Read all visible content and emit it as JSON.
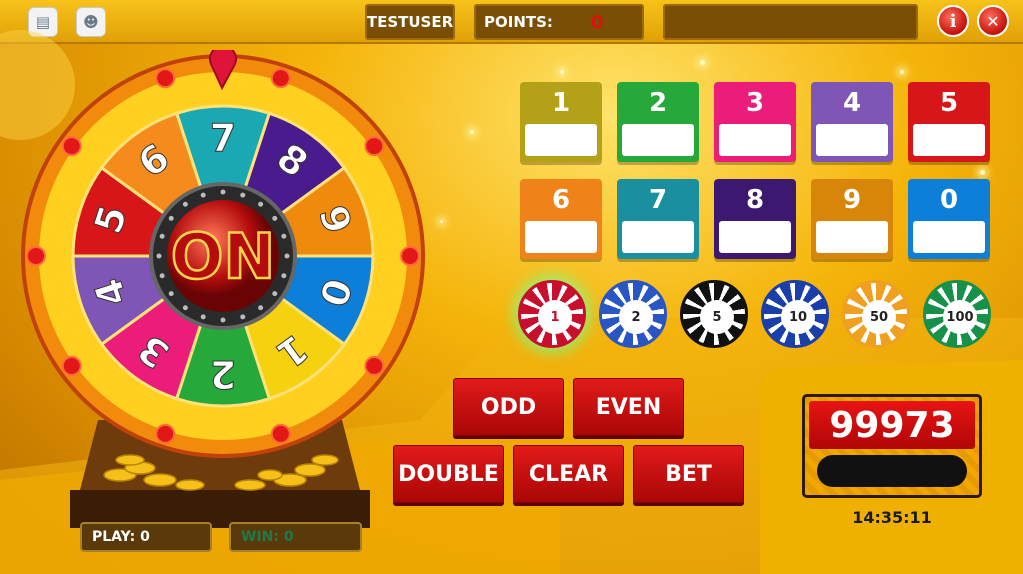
{
  "header": {
    "username": "TESTUSER",
    "points_label": "POINTS:",
    "points_value": "0",
    "info_label": "i",
    "close_label": "✕"
  },
  "wheel": {
    "pointer_number": "7",
    "center_text": "ON",
    "segments": [
      {
        "label": "7",
        "color": "#1aa9b3"
      },
      {
        "label": "8",
        "color": "#4a1b8c"
      },
      {
        "label": "9",
        "color": "#f08a0c"
      },
      {
        "label": "0",
        "color": "#0e7fd8"
      },
      {
        "label": "1",
        "color": "#f5d10f"
      },
      {
        "label": "2",
        "color": "#27a83a"
      },
      {
        "label": "3",
        "color": "#ec1d7a"
      },
      {
        "label": "4",
        "color": "#7f55b5"
      },
      {
        "label": "5",
        "color": "#d8161a"
      },
      {
        "label": "6",
        "color": "#f58b1d"
      }
    ]
  },
  "number_tiles": [
    {
      "label": "1",
      "color": "#b3a218"
    },
    {
      "label": "2",
      "color": "#27a83a"
    },
    {
      "label": "3",
      "color": "#ec1d7a"
    },
    {
      "label": "4",
      "color": "#7f55b5"
    },
    {
      "label": "5",
      "color": "#d8161a"
    },
    {
      "label": "6",
      "color": "#f0821a"
    },
    {
      "label": "7",
      "color": "#1a8fa0"
    },
    {
      "label": "8",
      "color": "#3c1870"
    },
    {
      "label": "9",
      "color": "#d8860a"
    },
    {
      "label": "0",
      "color": "#0e7fd8"
    }
  ],
  "chips": [
    {
      "label": "1",
      "color": "#c8102e"
    },
    {
      "label": "2",
      "color": "#2a56c4"
    },
    {
      "label": "5",
      "color": "#111111"
    },
    {
      "label": "10",
      "color": "#1a3faa"
    },
    {
      "label": "50",
      "color": "#f0a020"
    },
    {
      "label": "100",
      "color": "#17914a"
    }
  ],
  "buttons": {
    "odd": "ODD",
    "even": "EVEN",
    "double": "DOUBLE",
    "clear": "CLEAR",
    "bet": "BET"
  },
  "balance": {
    "value": "99973",
    "time": "14:35:11"
  },
  "stats": {
    "play": "PLAY: 0",
    "win": "WIN: 0"
  }
}
